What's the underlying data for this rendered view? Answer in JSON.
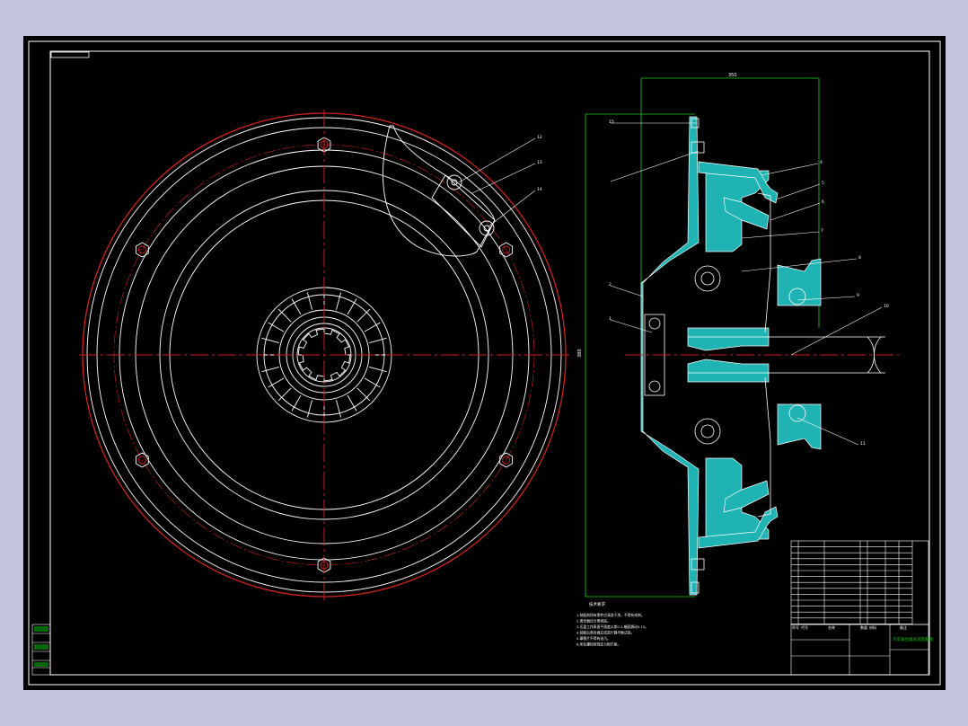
{
  "colors": {
    "background": "#c3c3dd",
    "sheet": "#000000",
    "line": "#ffffff",
    "center": "#cc2222",
    "section": "#1fb3b3",
    "dimension": "#22cc22",
    "title_block": "#00cc00"
  },
  "balloons": {
    "top": [
      "12",
      "13",
      "14"
    ],
    "right": [
      "4",
      "5",
      "6",
      "7",
      "8",
      "9",
      "10",
      "11",
      "15"
    ],
    "left": [
      "2",
      "1"
    ]
  },
  "dimensions": {
    "overall_width": "350",
    "overall_height": "380"
  },
  "notes": {
    "title": "技术要求",
    "lines": [
      "1.装配前所有零件应清洗干净，不得有毛刺。",
      "2.离合器应分离彻底。",
      "3.压盘工作表面平面度公差0.1,端面跳动0.15。",
      "4.装配后离合器总成进行静平衡试验。",
      "5.摩擦片不得有油污。",
      "6.所有螺栓按规定力矩拧紧。"
    ]
  },
  "title_block": {
    "drawing_title": "汽车离合器总成装配图",
    "headers": [
      "序号",
      "代号",
      "名称",
      "数量",
      "材料",
      "备注"
    ]
  }
}
